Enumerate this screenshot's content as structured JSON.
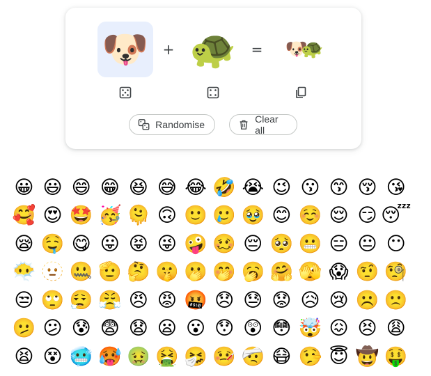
{
  "mixer": {
    "left_emoji": "🐶",
    "right_emoji": "🐢",
    "result_emoji": "🐶🐢",
    "plus": "+",
    "equals": "=",
    "left_selected": true
  },
  "actions": {
    "randomise_label": "Randomise",
    "clear_label": "Clear all"
  },
  "icons": {
    "dice": "dice-icon",
    "copy": "copy-icon",
    "shuffle": "shuffle-icon",
    "trash": "trash-icon"
  },
  "colors": {
    "selected_bg": "#e8effd",
    "border": "#c4c7c5",
    "text": "#3c4043"
  },
  "emoji_grid": [
    "😀",
    "😃",
    "😄",
    "😁",
    "😆",
    "😅",
    "😂",
    "🤣",
    "😭",
    "😉",
    "😗",
    "😙",
    "😚",
    "😘",
    "🥰",
    "😍",
    "🤩",
    "🥳",
    "🫠",
    "🙃",
    "🙂",
    "🥲",
    "🥹",
    "😊",
    "☺️",
    "😌",
    "😏",
    "😴",
    "😪",
    "🤤",
    "😋",
    "😛",
    "😝",
    "😜",
    "🤪",
    "🥴",
    "😔",
    "🥺",
    "😬",
    "😑",
    "😐",
    "😶",
    "😶‍🌫️",
    "🫥",
    "🤐",
    "🫡",
    "🤔",
    "🤫",
    "🫢",
    "🤭",
    "🥱",
    "🤗",
    "🫣",
    "😱",
    "🤨",
    "🧐",
    "😒",
    "🙄",
    "😮‍💨",
    "😤",
    "😠",
    "😡",
    "🤬",
    "😞",
    "😓",
    "😟",
    "😥",
    "😢",
    "☹️",
    "🙁",
    "🫤",
    "😕",
    "😰",
    "😨",
    "😧",
    "😦",
    "😮",
    "😯",
    "😲",
    "😳",
    "🤯",
    "😖",
    "😣",
    "😩",
    "😫",
    "😵",
    "🥶",
    "🥵",
    "🤢",
    "🤮",
    "🤧",
    "🤒",
    "🤕",
    "😷",
    "🤥",
    "😇",
    "🤠",
    "🤑"
  ]
}
